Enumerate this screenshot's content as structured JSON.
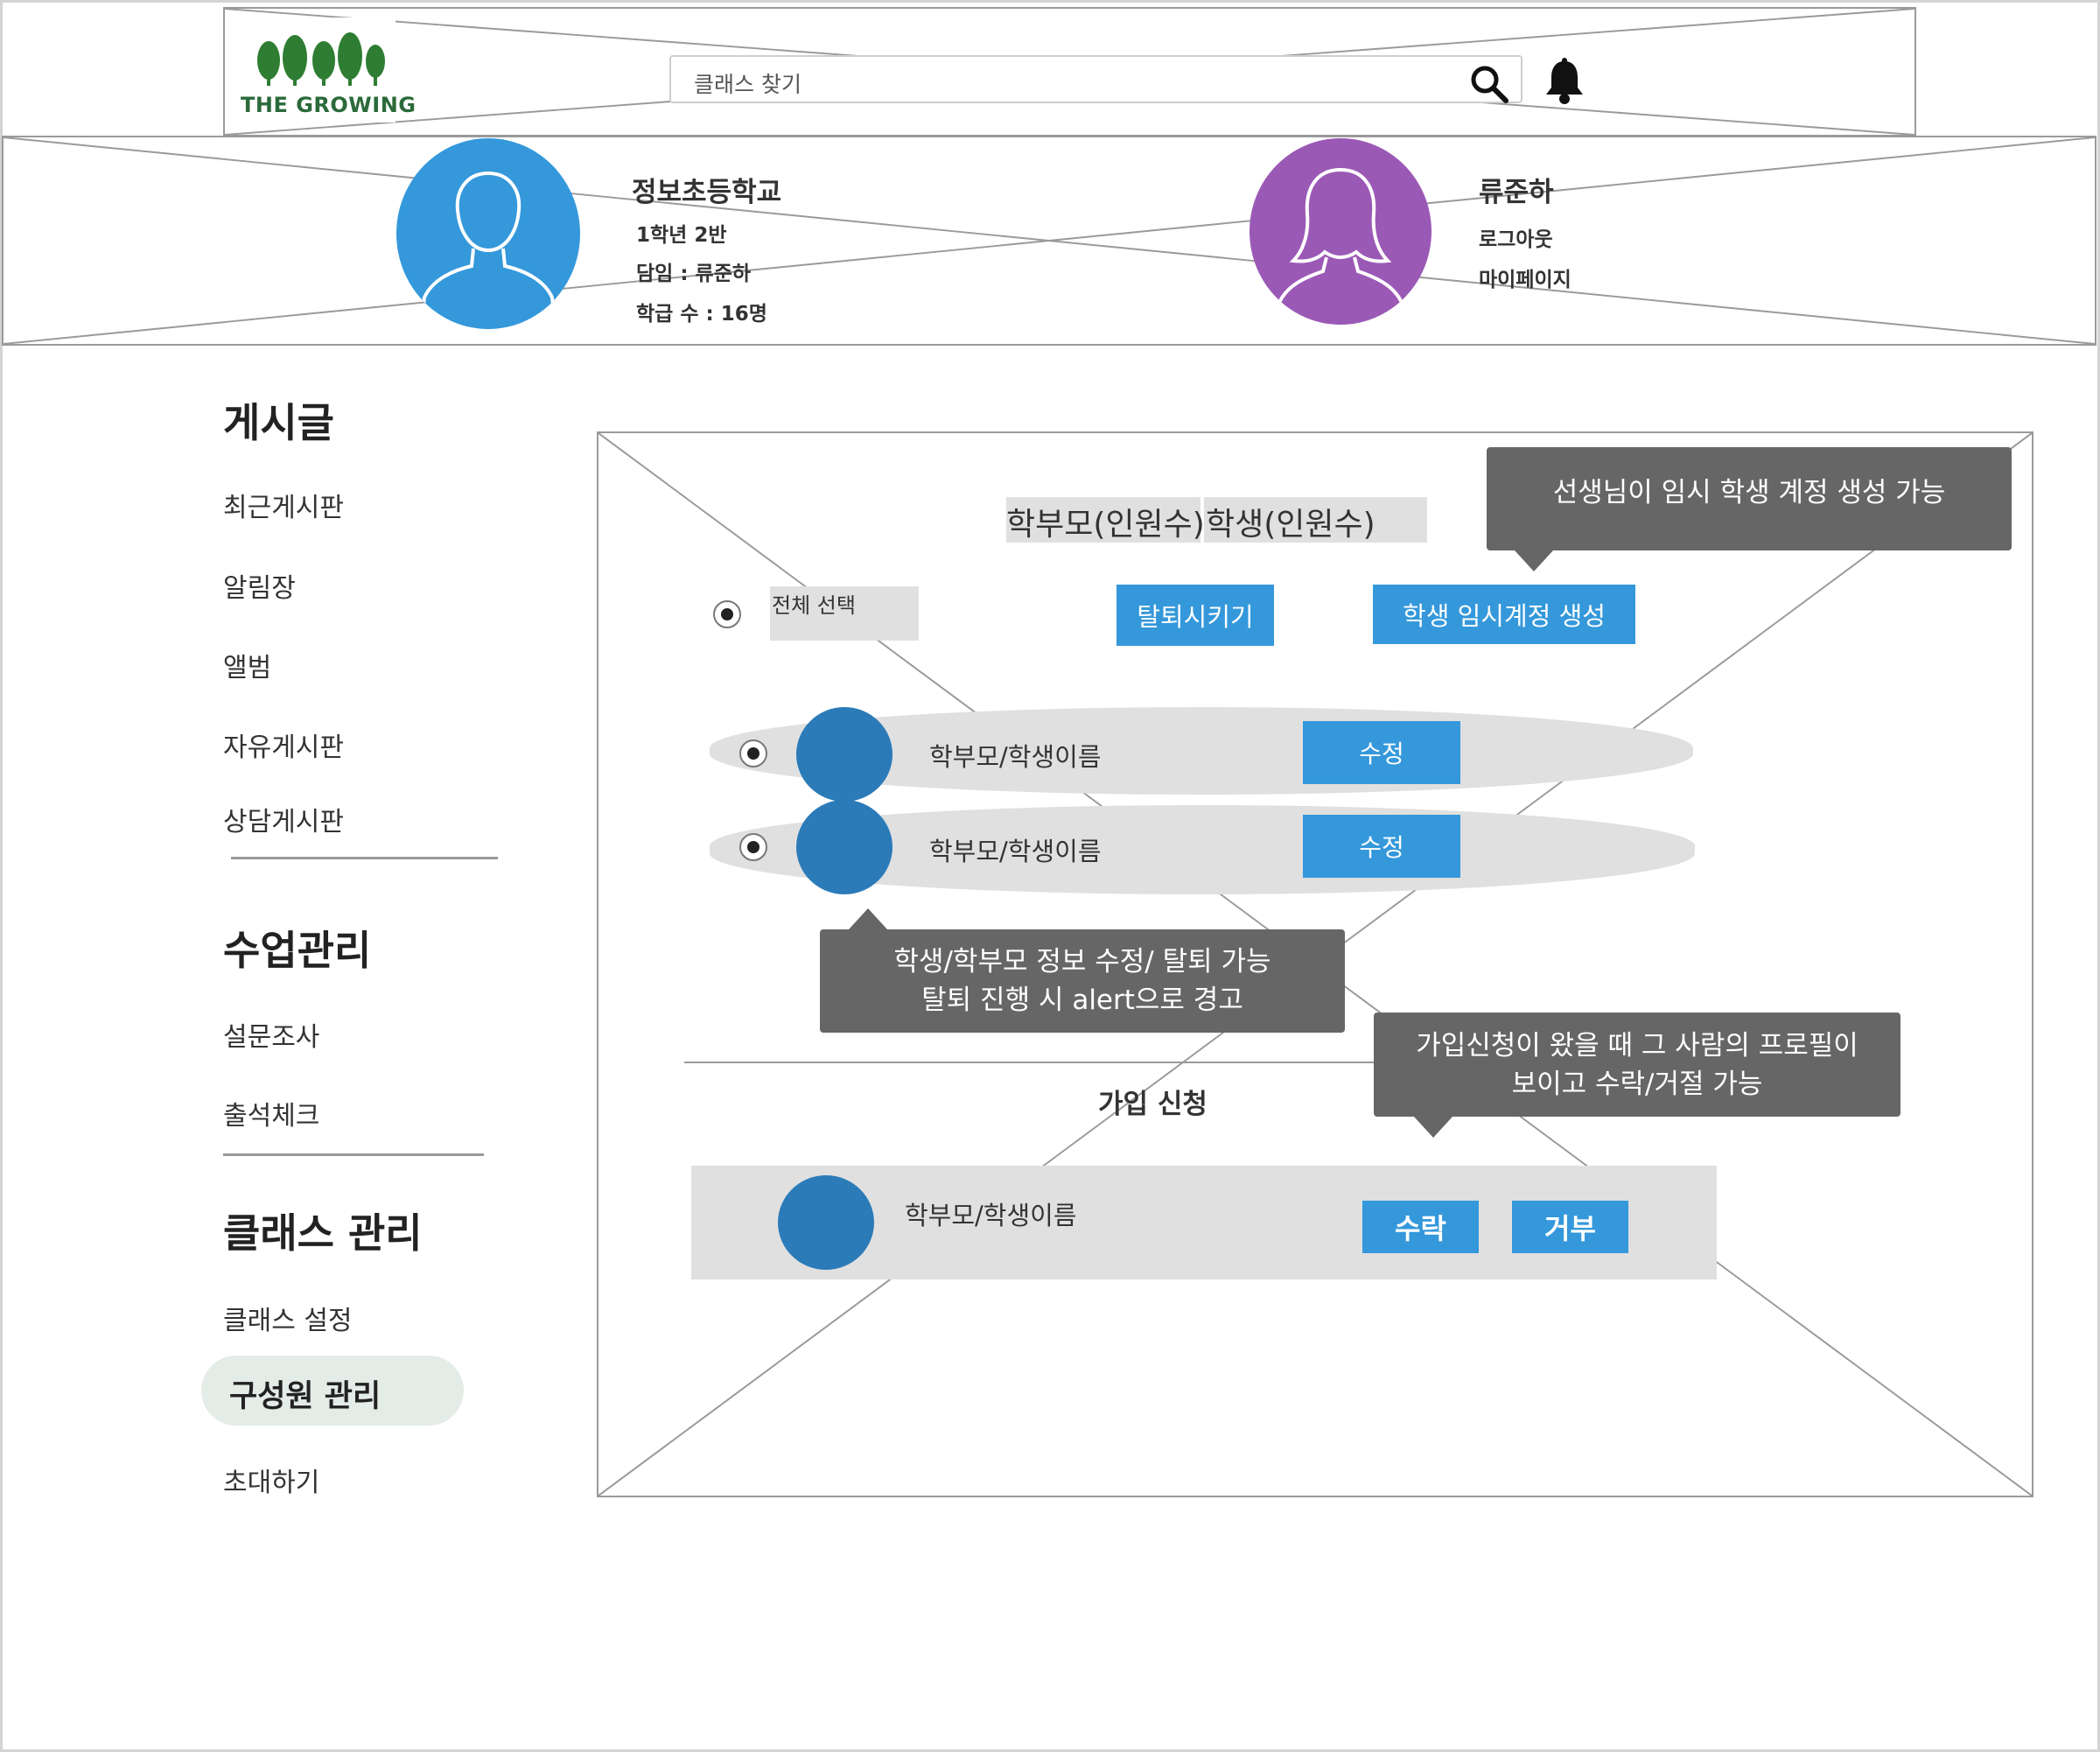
{
  "header": {
    "logo_text": "THE GROWING",
    "search_placeholder": "클래스 찾기"
  },
  "class_info": {
    "school": "정보초등학교",
    "grade_class": "1학년 2반",
    "teacher": "담임 : 류준하",
    "student_count": "학급 수 : 16명"
  },
  "user": {
    "name": "류준하",
    "logout": "로그아웃",
    "mypage": "마이페이지"
  },
  "sidebar": {
    "posts": {
      "heading": "게시글",
      "items": [
        "최근게시판",
        "알림장",
        "앨범",
        "자유게시판",
        "상담게시판"
      ]
    },
    "lessons": {
      "heading": "수업관리",
      "items": [
        "설문조사",
        "출석체크"
      ]
    },
    "class_manage": {
      "heading": "클래스 관리",
      "items": [
        "클래스 설정",
        "구성원 관리",
        "초대하기"
      ],
      "active": "구성원 관리"
    }
  },
  "main": {
    "tab_parents": "학부모(인원수)",
    "tab_students": "학생(인원수)",
    "select_all": "전체 선택",
    "withdraw_button": "탈퇴시키기",
    "create_temp_button": "학생 임시계정 생성",
    "members": [
      {
        "name": "학부모/학생이름",
        "edit": "수정"
      },
      {
        "name": "학부모/학생이름",
        "edit": "수정"
      }
    ],
    "join_title": "가입 신청",
    "join_request": {
      "name": "학부모/학생이름",
      "accept": "수락",
      "reject": "거부"
    }
  },
  "callouts": {
    "temp_account": "선생님이 임시 학생 계정 생성 가능",
    "edit_info_line1": "학생/학부모 정보 수정/ 탈퇴 가능",
    "edit_info_line2": "탈퇴 진행 시 alert으로 경고",
    "join_line1": "가입신청이 왔을 때 그 사람의 프로필이",
    "join_line2": "보이고 수락/거절 가능"
  },
  "colors": {
    "primary_button": "#3498db",
    "avatar_teacher": "#3498db",
    "avatar_user": "#9b59b6",
    "callout_bg": "#666666",
    "logo_green": "#2b6a3a",
    "active_nav_bg": "#e3ece6"
  },
  "icons": {
    "search": "search-icon",
    "bell": "bell-icon",
    "avatar": "person-avatar-icon"
  }
}
